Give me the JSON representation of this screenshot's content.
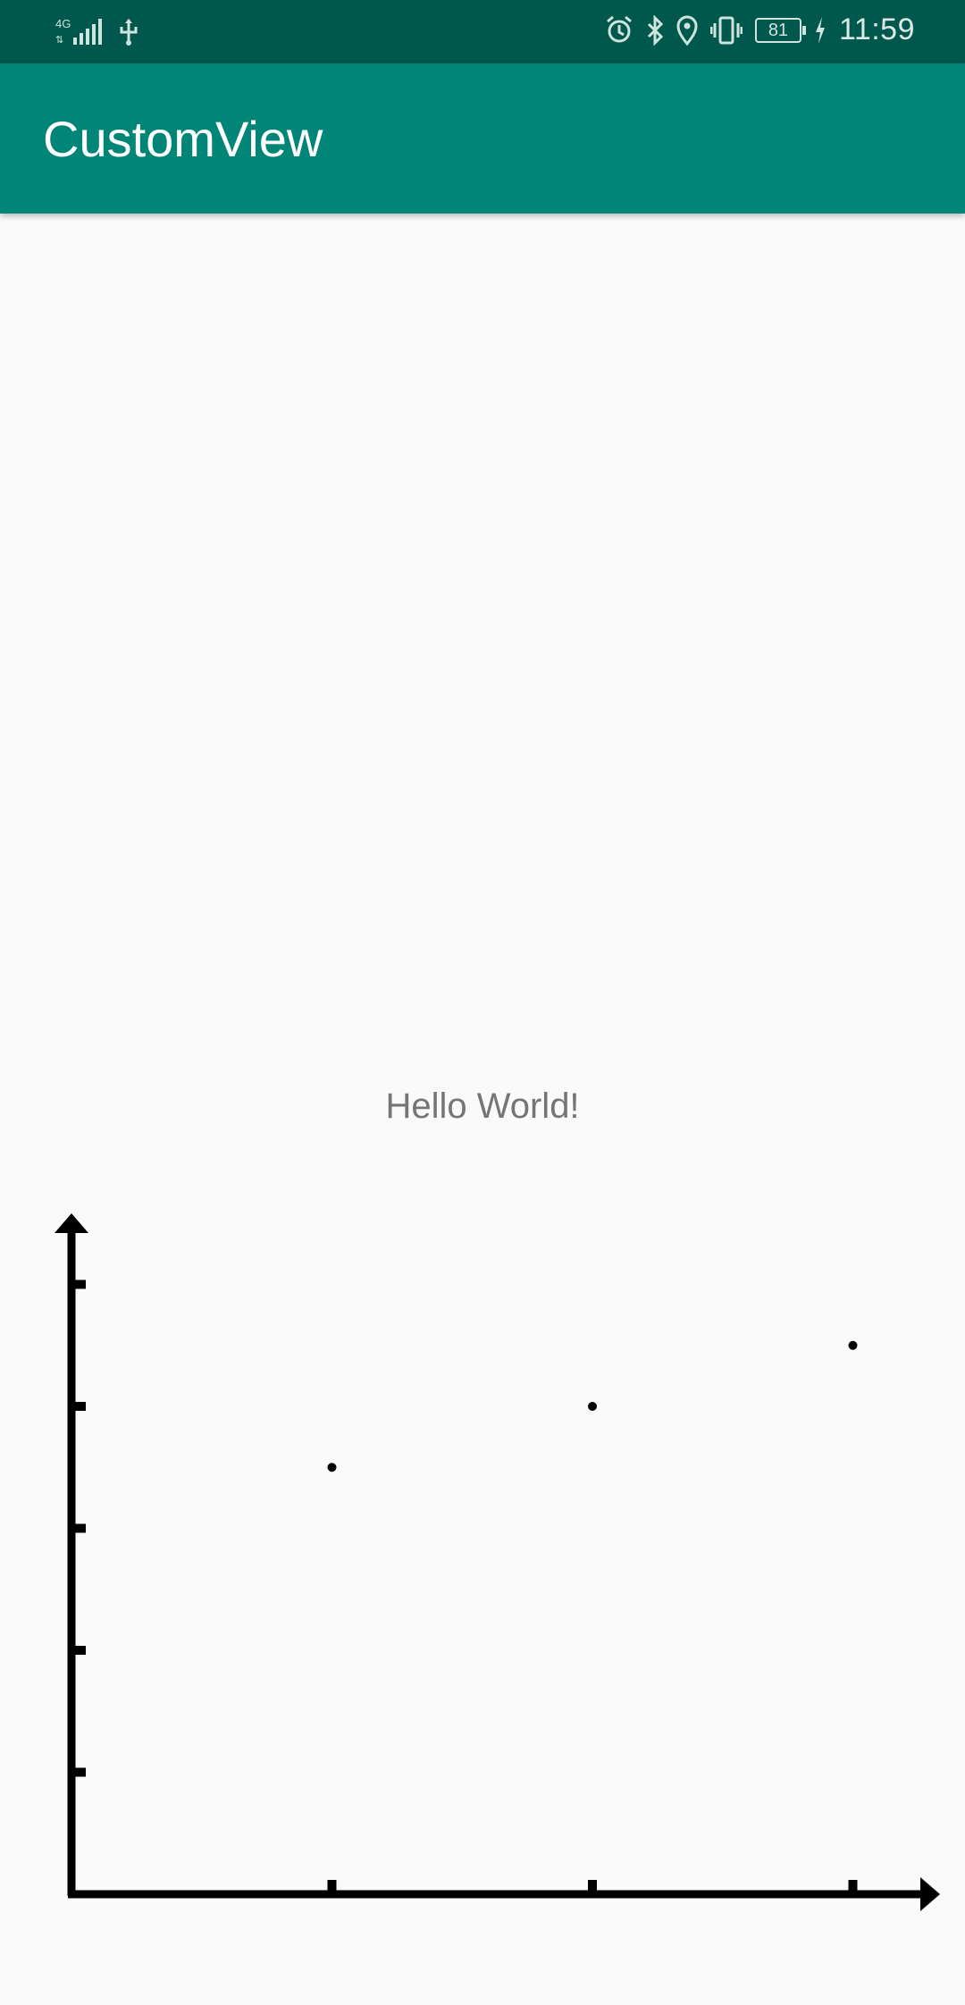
{
  "status_bar": {
    "time": "11:59",
    "battery_level": "81",
    "network_label": "4G",
    "icons": [
      "signal-icon",
      "usb-icon",
      "alarm-icon",
      "bluetooth-icon",
      "location-icon",
      "vibrate-icon",
      "battery-icon",
      "charging-icon"
    ]
  },
  "app_bar": {
    "title": "CustomView",
    "color": "#008577"
  },
  "content": {
    "hello_text": "Hello World!"
  },
  "chart_data": {
    "type": "scatter",
    "title": "",
    "xlabel": "",
    "ylabel": "",
    "xlim": [
      0,
      3.3
    ],
    "ylim": [
      0,
      5.5
    ],
    "x_ticks": [
      1,
      2,
      3
    ],
    "y_ticks": [
      1,
      2,
      3,
      4,
      5
    ],
    "points": [
      {
        "x": 1,
        "y": 3.5
      },
      {
        "x": 2,
        "y": 4
      },
      {
        "x": 3,
        "y": 4.5
      }
    ],
    "grid": false
  }
}
